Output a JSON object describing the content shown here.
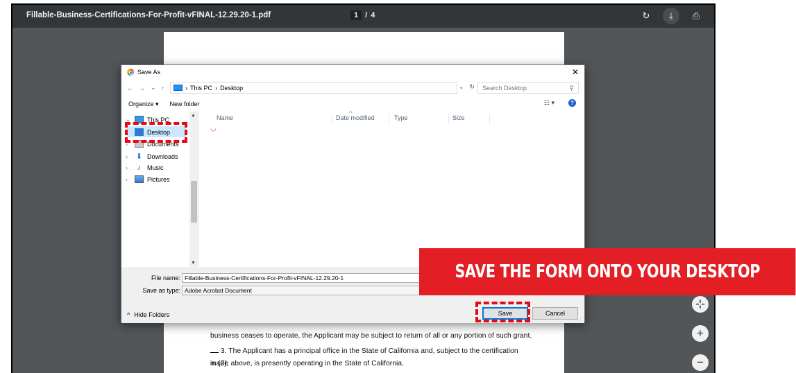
{
  "viewer": {
    "filename": "Fillable-Business-Certifications-For-Profit-vFINAL-12.29.20-1.pdf",
    "page_current": "1",
    "page_separator": "/",
    "page_total": "4",
    "icons": [
      "rotate-icon",
      "download-icon",
      "print-icon"
    ]
  },
  "pdf_text": {
    "line1": "business ceases to operate, the Applicant may be subject to return of all or any portion of such grant.",
    "line2": "3. The Applicant has a principal office in the State of California and, subject to the certification made",
    "line3": "in (2), above, is presently operating in the State of California."
  },
  "dialog": {
    "title": "Save As",
    "breadcrumb": [
      "This PC",
      "Desktop"
    ],
    "search_placeholder": "Search Desktop",
    "organize": "Organize ▾",
    "new_folder": "New folder",
    "nav_items": [
      {
        "label": "This PC"
      },
      {
        "label": "Desktop"
      },
      {
        "label": "Documents"
      },
      {
        "label": "Downloads"
      },
      {
        "label": "Music"
      },
      {
        "label": "Pictures"
      }
    ],
    "columns": [
      "Name",
      "Date modified",
      "Type",
      "Size"
    ],
    "file_name_label": "File name:",
    "file_name_value": "Fillable-Business-Certifications-For-Profit-vFINAL-12.29.20-1",
    "save_type_label": "Save as type:",
    "save_type_value": "Adobe Acrobat Document",
    "hide_folders": "Hide Folders",
    "save": "Save",
    "cancel": "Cancel"
  },
  "banner": {
    "text": "SAVE THE FORM ONTO YOUR DESKTOP",
    "color": "#e31e24"
  }
}
